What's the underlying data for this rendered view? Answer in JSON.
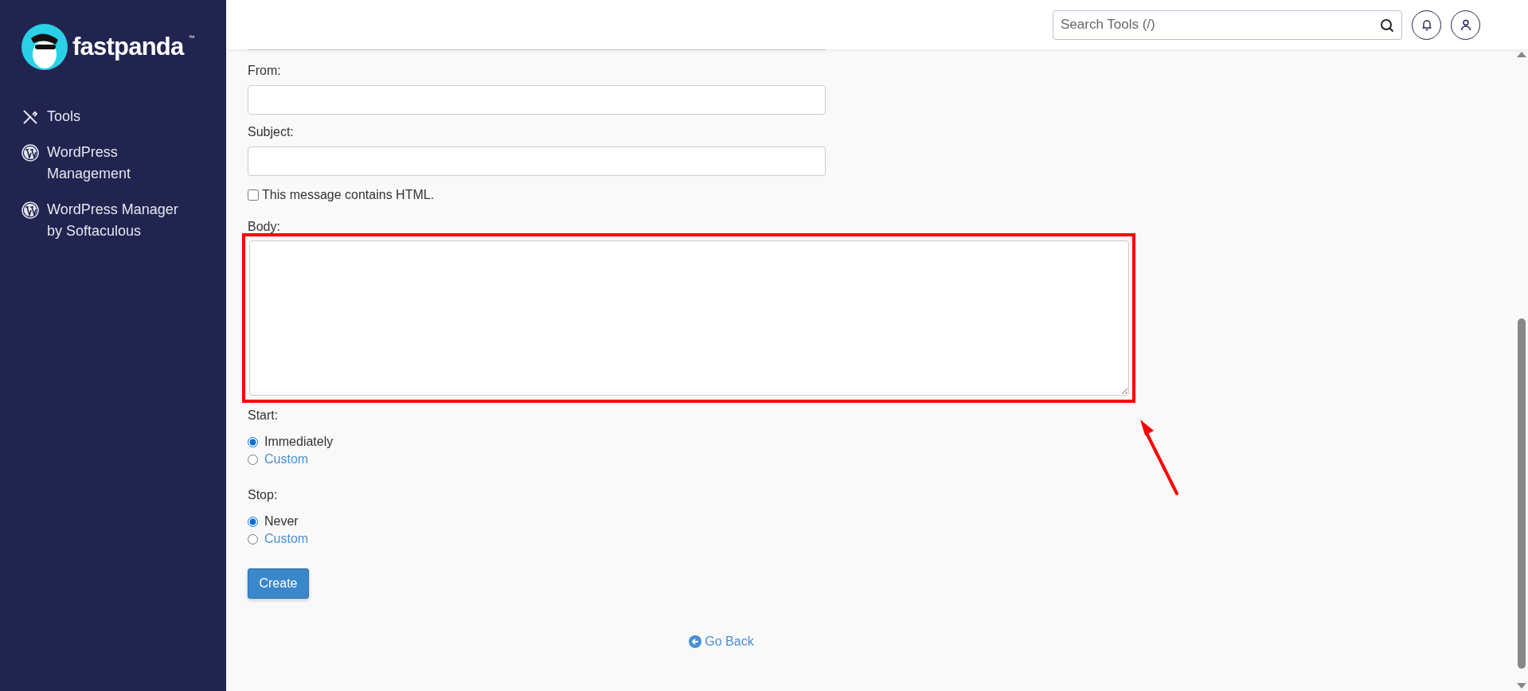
{
  "sidebar": {
    "logo": {
      "text": "fastpanda",
      "mark": "™"
    },
    "items": [
      {
        "label": "Tools",
        "kind": "tools"
      },
      {
        "label": "WordPress Management",
        "kind": "wordpress"
      },
      {
        "label": "WordPress Manager by Softaculous",
        "kind": "wordpress"
      }
    ]
  },
  "header": {
    "search": {
      "placeholder": "Search Tools (/)"
    }
  },
  "form": {
    "fields": [
      {
        "label": "From:"
      },
      {
        "label": "Subject:"
      }
    ],
    "html_checkbox": {
      "label": "This message contains HTML.",
      "checked": false
    },
    "body": {
      "label": "Body:",
      "highlighted": true
    },
    "radio_groups": [
      {
        "label": "Start:",
        "options": [
          {
            "label": "Immediately",
            "selected": true,
            "kind": "text"
          },
          {
            "label": "Custom",
            "selected": false,
            "kind": "link"
          }
        ]
      },
      {
        "label": "Stop:",
        "options": [
          {
            "label": "Never",
            "selected": true,
            "kind": "text"
          },
          {
            "label": "Custom",
            "selected": false,
            "kind": "link"
          }
        ]
      }
    ],
    "submit": "Create"
  },
  "back_link": "Go Back"
}
